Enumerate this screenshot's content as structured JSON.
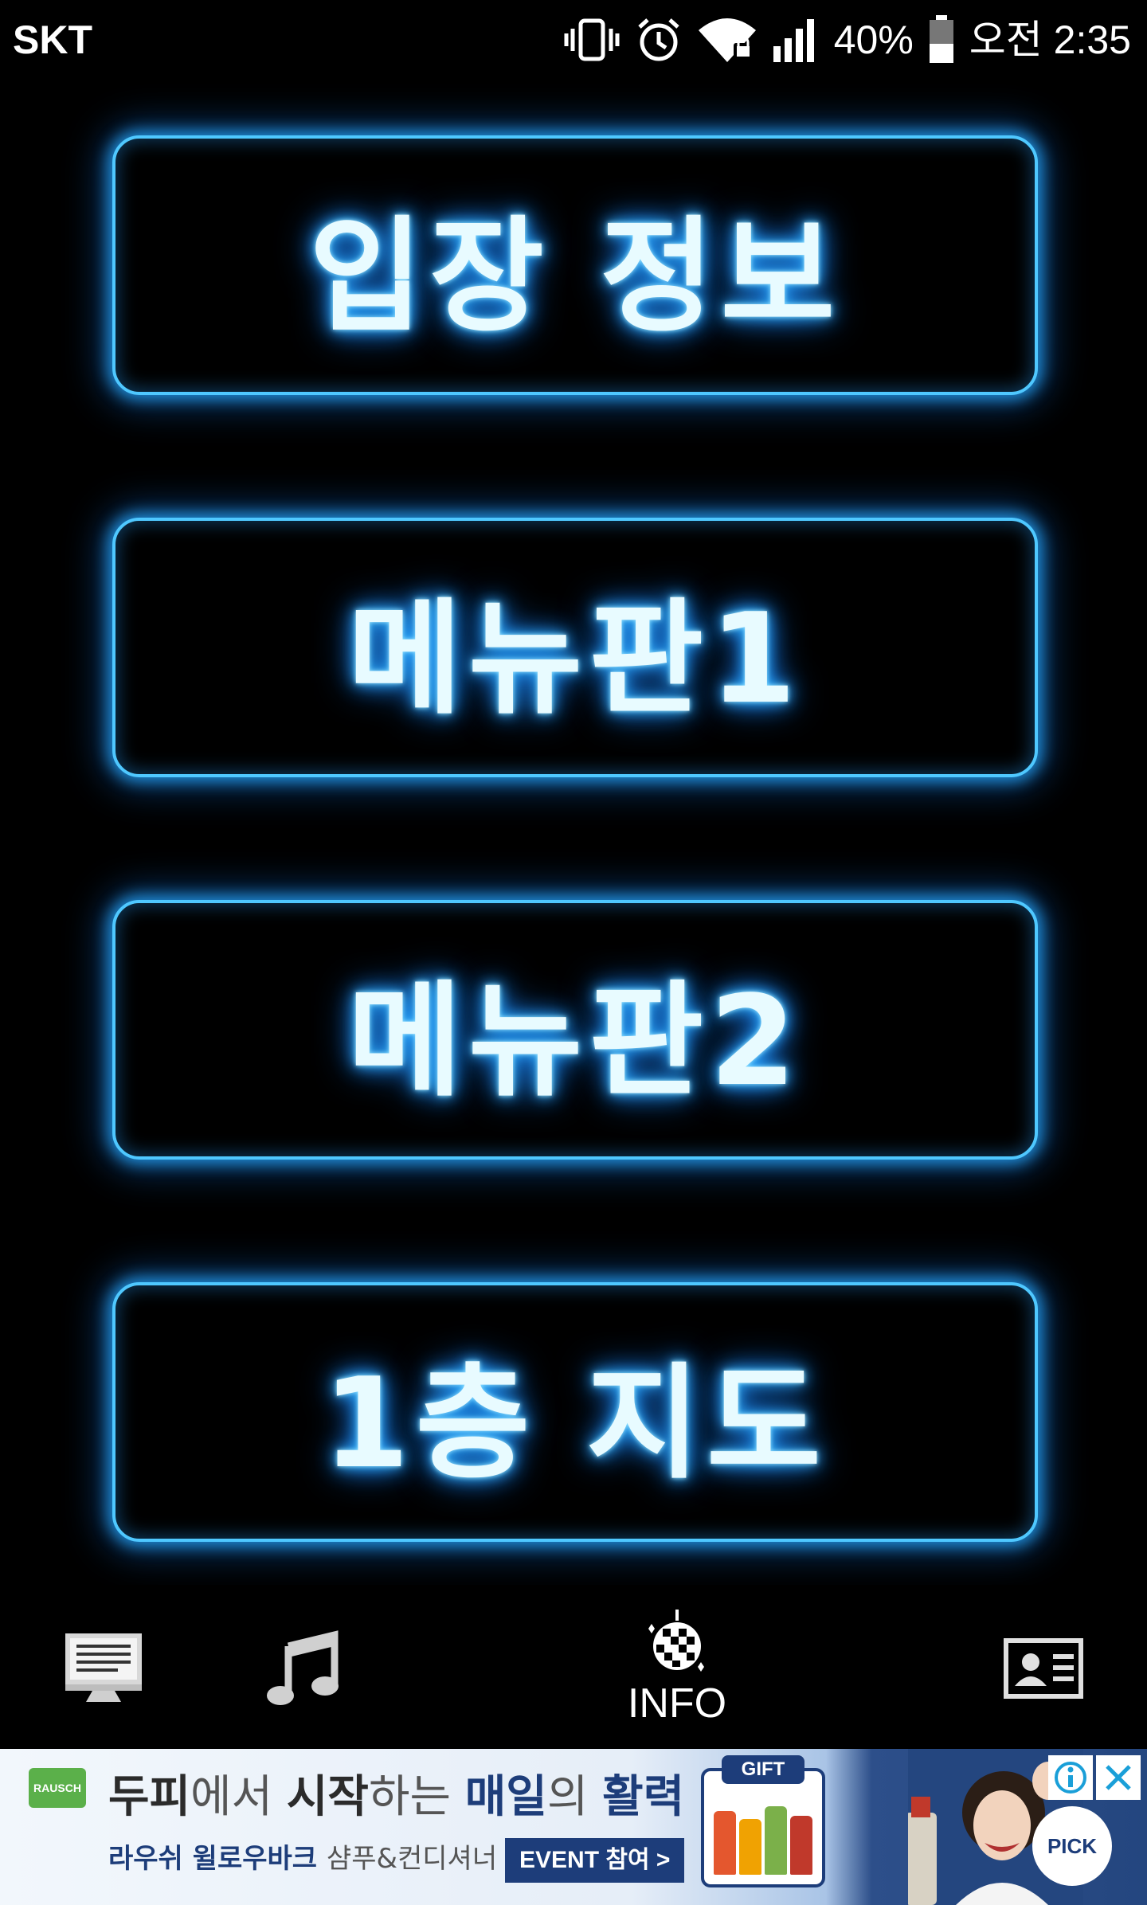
{
  "status_bar": {
    "carrier": "SKT",
    "battery_percent": "40%",
    "time": "오전 2:35",
    "icons": [
      "vibrate-icon",
      "alarm-icon",
      "wifi-locked-icon",
      "signal-icon",
      "battery-icon"
    ]
  },
  "menu": {
    "buttons": [
      {
        "label": "입장 정보"
      },
      {
        "label": "메뉴판1"
      },
      {
        "label": "메뉴판2"
      },
      {
        "label": "1층 지도"
      }
    ],
    "accent_color": "#4fc8ff"
  },
  "bottom_nav": {
    "items": [
      {
        "icon": "monitor-icon",
        "label": ""
      },
      {
        "icon": "music-note-icon",
        "label": ""
      },
      {
        "icon": "disco-ball-icon",
        "label": "INFO"
      },
      {
        "icon": "id-card-icon",
        "label": ""
      }
    ],
    "active_index": 2
  },
  "ad": {
    "brand": "RAUSCH",
    "headline_part1": "두피",
    "headline_part2": "에서 ",
    "headline_part3": "시작",
    "headline_part4": "하는 ",
    "headline_part5": "매일",
    "headline_part6": "의 ",
    "headline_part7": "활력",
    "sub_bold": "라우쉬 윌로우바크 ",
    "sub_light": "샴푸&컨디셔너",
    "event_label": "EVENT 참여 >",
    "gift_label": "GIFT",
    "pick_label": "PICK",
    "info_icon": "info-icon",
    "close_icon": "close-icon"
  }
}
